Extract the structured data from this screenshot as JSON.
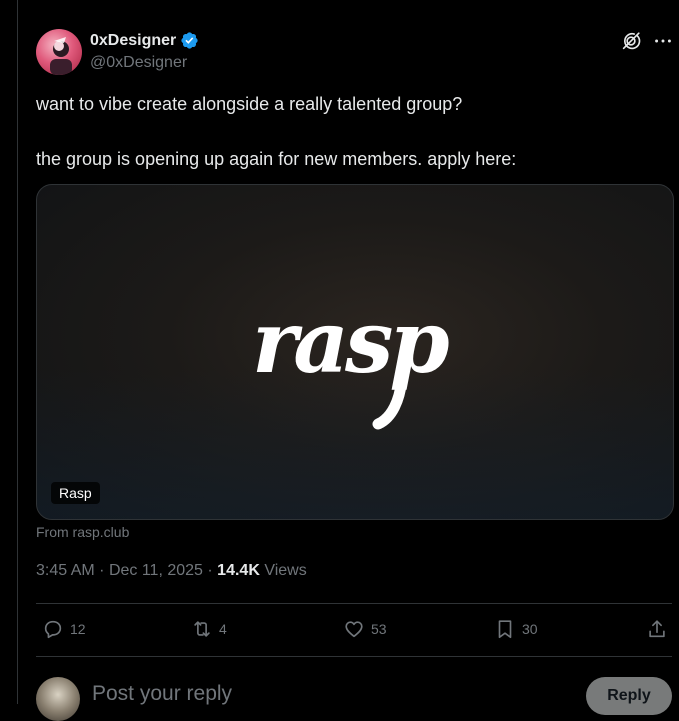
{
  "author": {
    "display_name": "0xDesigner",
    "handle": "@0xDesigner",
    "verified": true
  },
  "tweet": {
    "line1": "want to vibe create alongside a really talented group?",
    "line2": "the group is opening up again for new members. apply here:"
  },
  "card": {
    "logo_text": "rasp",
    "badge": "Rasp",
    "source": "From rasp.club"
  },
  "meta": {
    "time": "3:45 AM",
    "separator": "·",
    "date": "Dec 11, 2025",
    "views_count": "14.4K",
    "views_label": "Views"
  },
  "actions": {
    "replies": "12",
    "reposts": "4",
    "likes": "53",
    "bookmarks": "30"
  },
  "reply_box": {
    "placeholder": "Post your reply",
    "button_label": "Reply"
  },
  "colors": {
    "background": "#000000",
    "text": "#e7e9ea",
    "muted": "#71767b",
    "verified": "#1d9bf0",
    "border": "#2f3336"
  },
  "icons": [
    "verified-badge-icon",
    "grok-icon",
    "more-icon",
    "reply-icon",
    "repost-icon",
    "like-icon",
    "bookmark-icon",
    "share-icon"
  ]
}
